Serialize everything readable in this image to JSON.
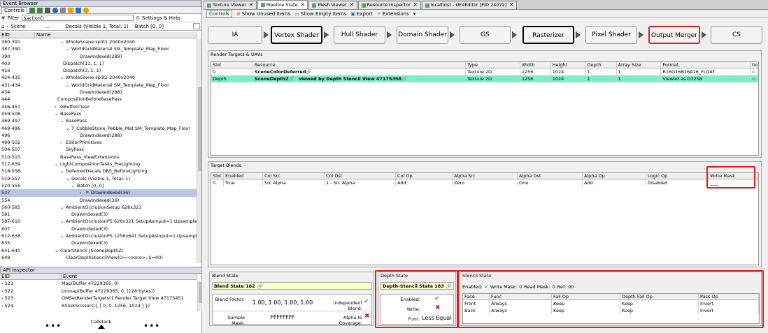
{
  "event_browser": {
    "title": "Event Browser",
    "tab_controls": "Controls",
    "filter_label": "Filter",
    "filter_value": "$action()",
    "settings_help": "Settings & Help",
    "scene_label": "Scene",
    "decals_label": "Decals (Visible 1, Total: 1)",
    "batch_label": "Batch [0, 0]",
    "col_eid": "EID",
    "col_name": "Name",
    "rows": [
      {
        "eid": "380-391",
        "name": "WholeScene split1 2040x2040",
        "indent": 9,
        "arrow": "v"
      },
      {
        "eid": "387-390",
        "name": "WorldGridMaterial SM_Template_Map_Floor",
        "indent": 11,
        "arrow": "v"
      },
      {
        "eid": "390",
        "name": "DrawIndexed(288)",
        "indent": 16,
        "arrow": ""
      },
      {
        "eid": "403",
        "name": "Dispatch(11, 1, 1)",
        "indent": 10,
        "arrow": ""
      },
      {
        "eid": "416",
        "name": "Dispatch(3, 1, 1)",
        "indent": 10,
        "arrow": ""
      },
      {
        "eid": "424-435",
        "name": "WholeScene split2 2040x2040",
        "indent": 9,
        "arrow": "v"
      },
      {
        "eid": "431-434",
        "name": "WorldGridMaterial SM_Template_Map_Floor",
        "indent": 11,
        "arrow": "v"
      },
      {
        "eid": "434",
        "name": "DrawIndexed(288)",
        "indent": 16,
        "arrow": ""
      },
      {
        "eid": "444",
        "name": "CompositionBeforeBasePass",
        "indent": 8,
        "arrow": ""
      },
      {
        "eid": "446-457",
        "name": "GBufferClear",
        "indent": 7,
        "arrow": ">"
      },
      {
        "eid": "459-508",
        "name": "BasePass",
        "indent": 7,
        "arrow": "v"
      },
      {
        "eid": "469-497",
        "name": "BasePass",
        "indent": 9,
        "arrow": "v"
      },
      {
        "eid": "469-496",
        "name": "T_CobbleStone_Pebble_Mat SM_Template_Map_Floor",
        "indent": 11,
        "arrow": "v"
      },
      {
        "eid": "496",
        "name": "DrawIndexed(288)",
        "indent": 16,
        "arrow": ""
      },
      {
        "eid": "499-502",
        "name": "EditorPrimitives",
        "indent": 9,
        "arrow": ">"
      },
      {
        "eid": "504-507",
        "name": "SkyPass",
        "indent": 11,
        "arrow": ""
      },
      {
        "eid": "510-515",
        "name": "BasePass_ViewExtensions",
        "indent": 9,
        "arrow": ""
      },
      {
        "eid": "517-639",
        "name": "LightCompositionTasks_PreLighting",
        "indent": 7,
        "arrow": "v"
      },
      {
        "eid": "518-558",
        "name": "DeferredDecals DBS_BeforeLighting",
        "indent": 9,
        "arrow": "v"
      },
      {
        "eid": "519-557",
        "name": "Decals (Visible 1, Total: 1)",
        "indent": 11,
        "arrow": "v"
      },
      {
        "eid": "520-556",
        "name": "Batch [0, 0]",
        "indent": 13,
        "arrow": "v"
      },
      {
        "eid": "537",
        "name": "DrawIndexed(36)",
        "indent": 16,
        "arrow": ">",
        "selected": true
      },
      {
        "eid": "554",
        "name": "DrawIndexed(36)",
        "indent": 16,
        "arrow": ""
      },
      {
        "eid": "560-585",
        "name": "AmbientOcclusionSetup 628x321",
        "indent": 9,
        "arrow": "v"
      },
      {
        "eid": "581",
        "name": "DrawIndexed(3)",
        "indent": 13,
        "arrow": ""
      },
      {
        "eid": "587-610",
        "name": "AmbientOcclusionPS 628x321 SetupAsInput=1 Upsample=0 Sh...",
        "indent": 9,
        "arrow": "v"
      },
      {
        "eid": "607",
        "name": "DrawIndexed(3)",
        "indent": 13,
        "arrow": ""
      },
      {
        "eid": "612-638",
        "name": "AmbientOcclusionPS 1256x641 SetupAsInput=1 Upsample=1 S...",
        "indent": 9,
        "arrow": "v"
      },
      {
        "eid": "635",
        "name": "DrawIndexed(3)",
        "indent": 13,
        "arrow": ""
      },
      {
        "eid": "641-640",
        "name": "ClearStencil (SceneDepthZ)",
        "indent": 7,
        "arrow": "v"
      },
      {
        "eid": "649",
        "name": "ClearDepthStencilView(D=<none>, S=00)",
        "indent": 11,
        "arrow": ""
      }
    ]
  },
  "api_inspector": {
    "title": "API Inspector",
    "col_eid": "EID",
    "col_event": "Event",
    "rows": [
      {
        "eid": "521",
        "event": "Map(Buffer 47229365, 0)"
      },
      {
        "eid": "522",
        "event": "Unmap(Buffer 47229365, 0, (128 bytes))"
      },
      {
        "eid": "523",
        "event": "OMSetRenderTargets({ Render Target View 47175451"
      },
      {
        "eid": "524",
        "event": "RSSetScissors({ [ 0, 0, 1256, 1024 ] })"
      }
    ],
    "callstack": "Callstack"
  },
  "doc_tabs": [
    {
      "label": "Texture Viewer",
      "active": false
    },
    {
      "label": "Pipeline State",
      "active": true
    },
    {
      "label": "Mesh Viewer",
      "active": false
    },
    {
      "label": "Resource Inspector",
      "active": false
    },
    {
      "label": "localhost - UE4Editor [PID 24072]",
      "active": false
    }
  ],
  "subtoolbar": {
    "controls": "Controls",
    "show_unused": "Show Unused Items",
    "show_empty": "Show Empty Items",
    "export": "Export",
    "extensions": "Extensions"
  },
  "pipeline_stages": [
    {
      "label": "IA",
      "state": "normal"
    },
    {
      "label": "Vertex Shader",
      "state": "black"
    },
    {
      "label": "Hull Shader",
      "state": "normal"
    },
    {
      "label": "Domain Shader",
      "state": "normal"
    },
    {
      "label": "GS",
      "state": "normal"
    },
    {
      "label": "Rasterizer",
      "state": "black"
    },
    {
      "label": "Pixel Shader",
      "state": "normal"
    },
    {
      "label": "Output Merger",
      "state": "red"
    },
    {
      "label": "CS",
      "state": "normal"
    }
  ],
  "render_targets": {
    "title": "Render Targets & UAVs",
    "headers": [
      "Slot",
      "Resource",
      "Type",
      "Width",
      "Height",
      "Depth",
      "Array Size",
      "Format",
      "Go"
    ],
    "rows": [
      {
        "slot": "0",
        "resource": "SceneColorDeferred",
        "type": "Texture 2D",
        "width": "1256",
        "height": "1024",
        "depth": "1",
        "array": "1",
        "format": "R16G16B16A16_FLOAT",
        "hl": false
      },
      {
        "slot": "Depth",
        "resource": "SceneDepthZ",
        "resource_extra": "viewed by Depth Stencil View 47175358",
        "type": "Texture 2D",
        "width": "1256",
        "height": "1024",
        "depth": "1",
        "array": "1",
        "format": "Viewed as D32S8",
        "hl": true
      }
    ]
  },
  "target_blends": {
    "title": "Target Blends",
    "headers": [
      "Slot",
      "Enabled",
      "Col Src",
      "Col Dst",
      "Col Op",
      "Alpha Src",
      "Alpha Dst",
      "Alpha Op",
      "Logic Op",
      "Write Mask"
    ],
    "rows": [
      {
        "cells": [
          "0",
          "True",
          "Src Alpha",
          "1 - Src Alpha",
          "Add",
          "Zero",
          "One",
          "Add",
          "Disabled",
          "____"
        ]
      }
    ]
  },
  "blend_state": {
    "title": "Blend State",
    "name": "Blend State 182",
    "blend_factor_label": "Blend Factor:",
    "blend_factor": "1.00,  1.00,  1.00,  1.00",
    "independent_label": "Independent Blend:",
    "sample_mask_label": "Sample Mask:",
    "sample_mask": "FFFFFFFF",
    "alpha_cov_label": "Alpha to Coverage:"
  },
  "depth_state": {
    "title": "Depth State",
    "name": "Depth-Stencil State 183",
    "enabled_label": "Enabled:",
    "write_label": "Write:",
    "func_label": "Func:",
    "func_value": "Less Equal"
  },
  "stencil_state": {
    "title": "Stencil State",
    "enabled_label": "Enabled:",
    "write_mask_label": "Write Mask:",
    "write_mask": "0",
    "read_mask_label": "Read Mask:",
    "read_mask": "0",
    "ref_label": "Ref:",
    "ref": "00",
    "headers": [
      "Face",
      "Func",
      "Fail Op",
      "Depth Fail Op",
      "Pass Op"
    ],
    "rows": [
      [
        "Front",
        "Always",
        "Keep",
        "Keep",
        "Invert"
      ],
      [
        "Back",
        "Always",
        "Keep",
        "Keep",
        "Invert"
      ]
    ]
  }
}
